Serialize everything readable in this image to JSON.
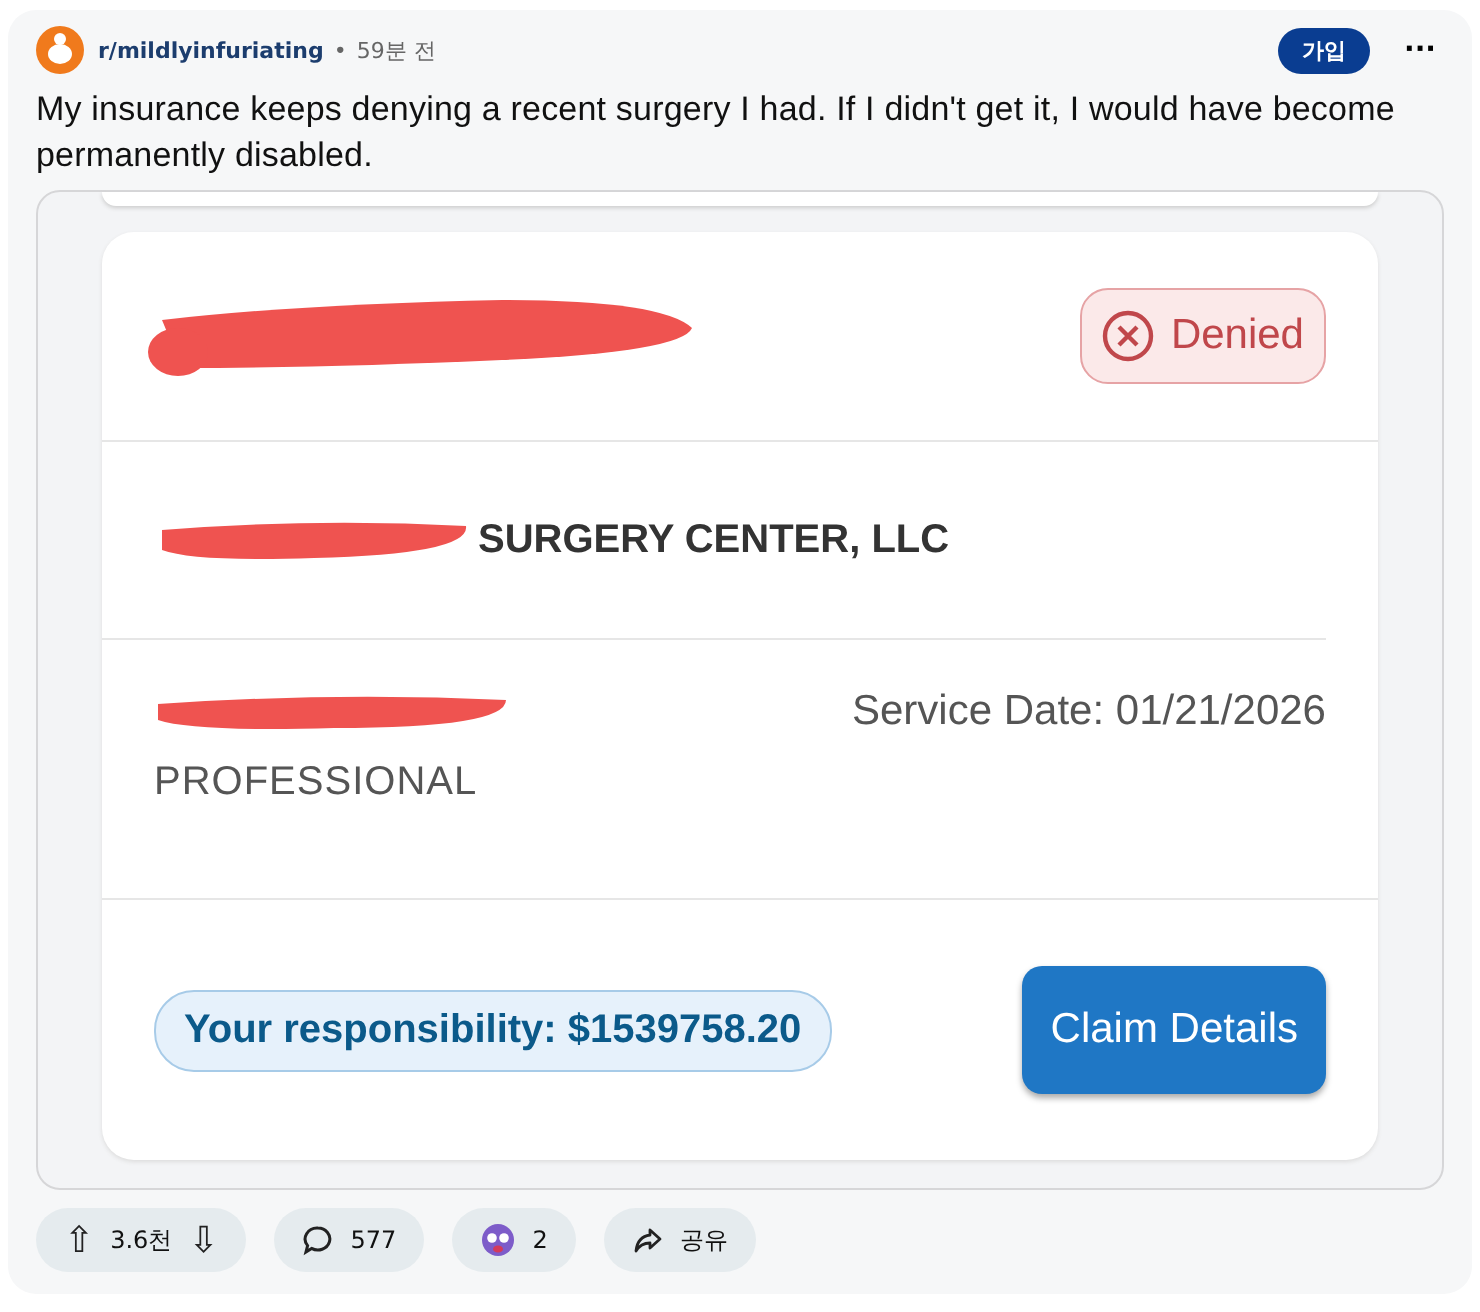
{
  "post": {
    "subreddit": "r/mildlyinfuriating",
    "separator": "•",
    "time": "59분 전",
    "join_button": "가입",
    "more_button": "···",
    "title": "My insurance keeps denying a recent surgery I had. If I didn't get it, I would have become permanently disabled."
  },
  "claim": {
    "status": {
      "kind": "denied",
      "label": "Denied"
    },
    "provider": "SURGERY CENTER, LLC",
    "service_date": "Service Date: 01/21/2026",
    "claim_type": "PROFESSIONAL",
    "responsibility": "Your responsibility: $1539758.20",
    "details_button": "Claim Details"
  },
  "actions": [
    {
      "kind": "vote",
      "upvote": "⇧",
      "count": "3.6천",
      "downvote": "⇩"
    },
    {
      "kind": "comments",
      "count": "577"
    },
    {
      "kind": "award",
      "count": "2"
    },
    {
      "kind": "share",
      "label": "공유"
    }
  ]
}
